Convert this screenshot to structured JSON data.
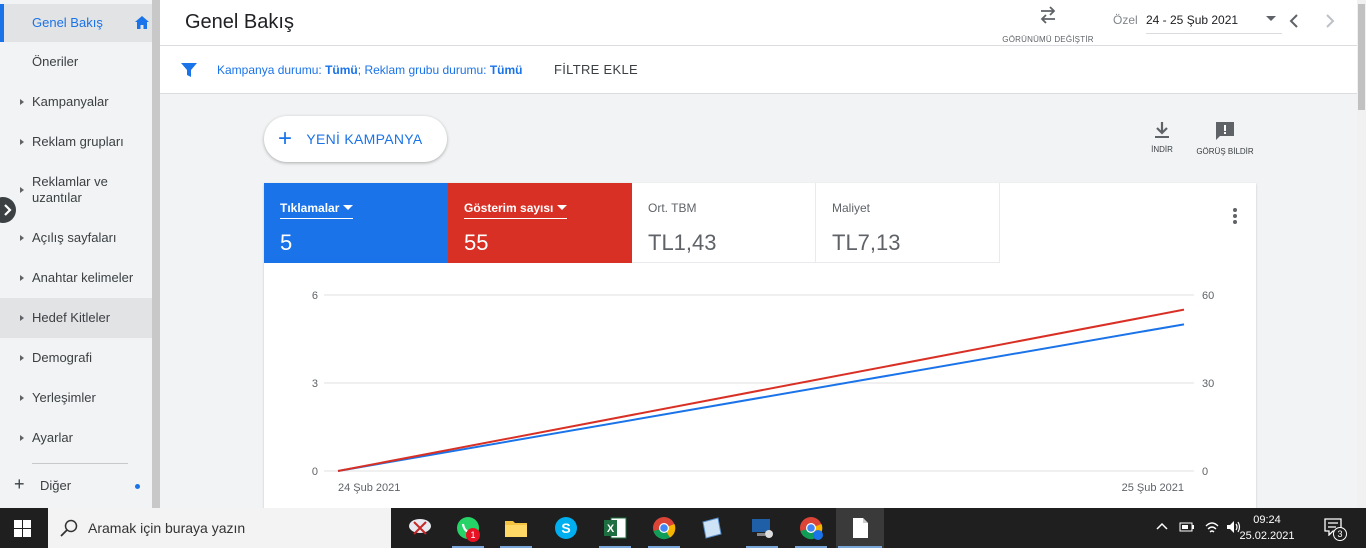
{
  "sidebar": {
    "items": [
      {
        "label": "Genel Bakış"
      },
      {
        "label": "Öneriler"
      },
      {
        "label": "Kampanyalar"
      },
      {
        "label": "Reklam grupları"
      },
      {
        "label": "Reklamlar ve uzantılar"
      },
      {
        "label": "Açılış sayfaları"
      },
      {
        "label": "Anahtar kelimeler"
      },
      {
        "label": "Hedef Kitleler"
      },
      {
        "label": "Demografi"
      },
      {
        "label": "Yerleşimler"
      },
      {
        "label": "Ayarlar"
      }
    ],
    "more_label": "Diğer"
  },
  "header": {
    "title": "Genel Bakış",
    "view_switch_label": "GÖRÜNÜMÜ DEĞİŞTİR",
    "date_prefix": "Özel",
    "date_range": "24 - 25 Şub 2021"
  },
  "filter": {
    "campaign_status_label": "Kampanya durumu:",
    "campaign_status_value": "Tümü",
    "separator": ";",
    "adgroup_status_label": "Reklam grubu durumu:",
    "adgroup_status_value": "Tümü",
    "add_filter_label": "FİLTRE EKLE"
  },
  "actions": {
    "new_campaign_label": "YENİ KAMPANYA",
    "download_label": "İNDİR",
    "feedback_label": "GÖRÜŞ BİLDİR"
  },
  "metrics": [
    {
      "name": "Tıklamalar",
      "value": "5",
      "color": "#1a73e8"
    },
    {
      "name": "Gösterim sayısı",
      "value": "55",
      "color": "#d93025"
    },
    {
      "name": "Ort. TBM",
      "value": "TL1,43"
    },
    {
      "name": "Maliyet",
      "value": "TL7,13"
    }
  ],
  "chart_data": {
    "type": "line",
    "x": [
      "24 Şub 2021",
      "25 Şub 2021"
    ],
    "series": [
      {
        "name": "Tıklamalar",
        "values": [
          0,
          5
        ],
        "axis": "left",
        "color": "#1a73e8"
      },
      {
        "name": "Gösterim sayısı",
        "values": [
          0,
          55
        ],
        "axis": "right",
        "color": "#d93025"
      }
    ],
    "y_left": {
      "ticks": [
        "0",
        "3",
        "6"
      ],
      "range": [
        0,
        6
      ]
    },
    "y_right": {
      "ticks": [
        "0",
        "30",
        "60"
      ],
      "range": [
        0,
        60
      ]
    },
    "grid": true
  },
  "taskbar": {
    "search_placeholder": "Aramak için buraya yazın",
    "whatsapp_badge": "1",
    "time": "09:24",
    "date": "25.02.2021",
    "notification_count": "3"
  }
}
